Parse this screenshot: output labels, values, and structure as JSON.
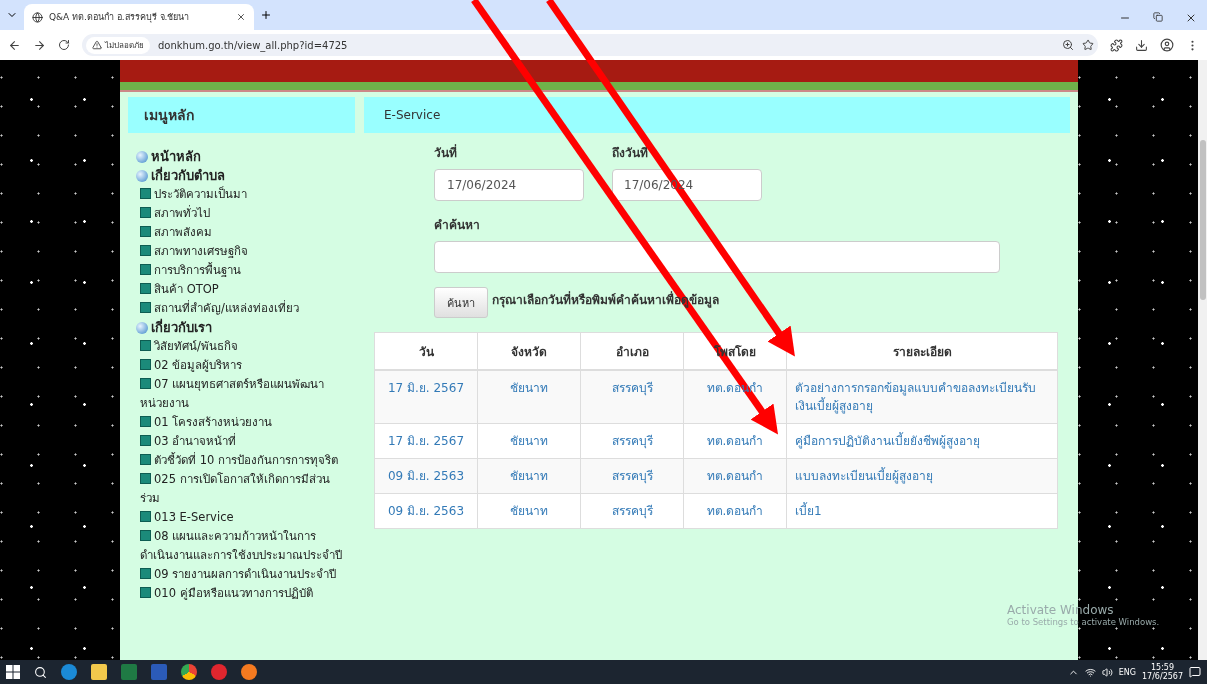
{
  "browser": {
    "tab_title": "Q&A ทต.ดอนกำ อ.สรรคบุรี จ.ชัยนา",
    "security_label": "ไม่ปลอดภัย",
    "url": "donkhum.go.th/view_all.php?id=4725"
  },
  "sidebar": {
    "title": "เมนูหลัก",
    "items": [
      {
        "label": "หน้าหลัก"
      },
      {
        "label": "เกี่ยวกับตำบล",
        "children": [
          {
            "label": "ประวัติความเป็นมา"
          },
          {
            "label": "สภาพทั่วไป"
          },
          {
            "label": "สภาพสังคม"
          },
          {
            "label": "สภาพทางเศรษฐกิจ"
          },
          {
            "label": "การบริการพื้นฐาน"
          },
          {
            "label": "สินค้า OTOP"
          },
          {
            "label": "สถานที่สำคัญ/แหล่งท่องเที่ยว"
          }
        ]
      },
      {
        "label": "เกี่ยวกับเรา",
        "children": [
          {
            "label": "วิสัยทัศน์/พันธกิจ"
          },
          {
            "label": "02 ข้อมูลผู้บริหาร"
          },
          {
            "label": "07 แผนยุทธศาสตร์หรือแผนพัฒนาหน่วยงาน"
          },
          {
            "label": "01 โครงสร้างหน่วยงาน"
          },
          {
            "label": "03 อำนาจหน้าที่"
          },
          {
            "label": "ตัวชี้วัดที่ 10 การป้องกันการการทุจริต"
          },
          {
            "label": "025 การเปิดโอกาสให้เกิดการมีส่วนร่วม"
          },
          {
            "label": "013 E-Service"
          },
          {
            "label": "08 แผนและความก้าวหน้าในการดำเนินงานและการใช้งบประมาณประจำปี"
          },
          {
            "label": "09 รายงานผลการดำเนินงานประจำปี"
          },
          {
            "label": "010 คู่มือหรือแนวทางการปฏิบัติ"
          }
        ]
      }
    ]
  },
  "main": {
    "title": "E-Service",
    "form": {
      "date_from": {
        "label": "วันที่",
        "value": "17/06/2024"
      },
      "date_to": {
        "label": "ถึงวันที่",
        "value": "17/06/2024"
      },
      "keyword": {
        "label": "คำค้นหา"
      },
      "search_button": "ค้นหา",
      "hint": "กรุณาเลือกวันที่หรือพิมพ์คำค้นหาเพื่อดูข้อมูล"
    },
    "table": {
      "columns": [
        "วัน",
        "จังหวัด",
        "อำเภอ",
        "โพสโดย",
        "รายละเอียด"
      ],
      "rows": [
        [
          "17 มิ.ย. 2567",
          "ชัยนาท",
          "สรรคบุรี",
          "ทต.ดอนกำ",
          "ตัวอย่างการกรอกข้อมูลแบบคำขอลงทะเบียนรับเงินเบี้ยผู้สูงอายุ"
        ],
        [
          "17 มิ.ย. 2567",
          "ชัยนาท",
          "สรรคบุรี",
          "ทต.ดอนกำ",
          "คู่มือการปฏิบัติงานเบี้ยยังชีพผู้สูงอายุ"
        ],
        [
          "09 มิ.ย. 2563",
          "ชัยนาท",
          "สรรคบุรี",
          "ทต.ดอนกำ",
          "แบบลงทะเบียนเบี้ยผู้สูงอายุ"
        ],
        [
          "09 มิ.ย. 2563",
          "ชัยนาท",
          "สรรคบุรี",
          "ทต.ดอนกำ",
          "เบี้ย1"
        ]
      ]
    }
  },
  "os_notice": {
    "title": "Activate Windows",
    "text": "Go to Settings to activate Windows."
  },
  "taskbar": {
    "language": "ENG",
    "time": "15:59",
    "date": "17/6/2567"
  }
}
